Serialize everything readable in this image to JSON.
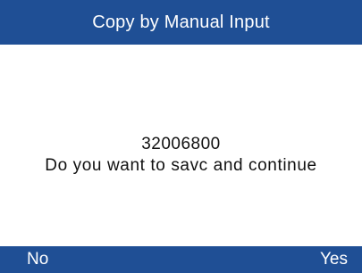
{
  "header": {
    "title": "Copy by Manual Input"
  },
  "dialog": {
    "code": "32006800",
    "message": "Do you want to savc and continue"
  },
  "softkeys": {
    "left_label": "No",
    "right_label": "Yes"
  },
  "colors": {
    "bar_background": "#1f4f95",
    "bar_text": "#ffffff",
    "content_background": "#ffffff",
    "content_text": "#111111"
  }
}
